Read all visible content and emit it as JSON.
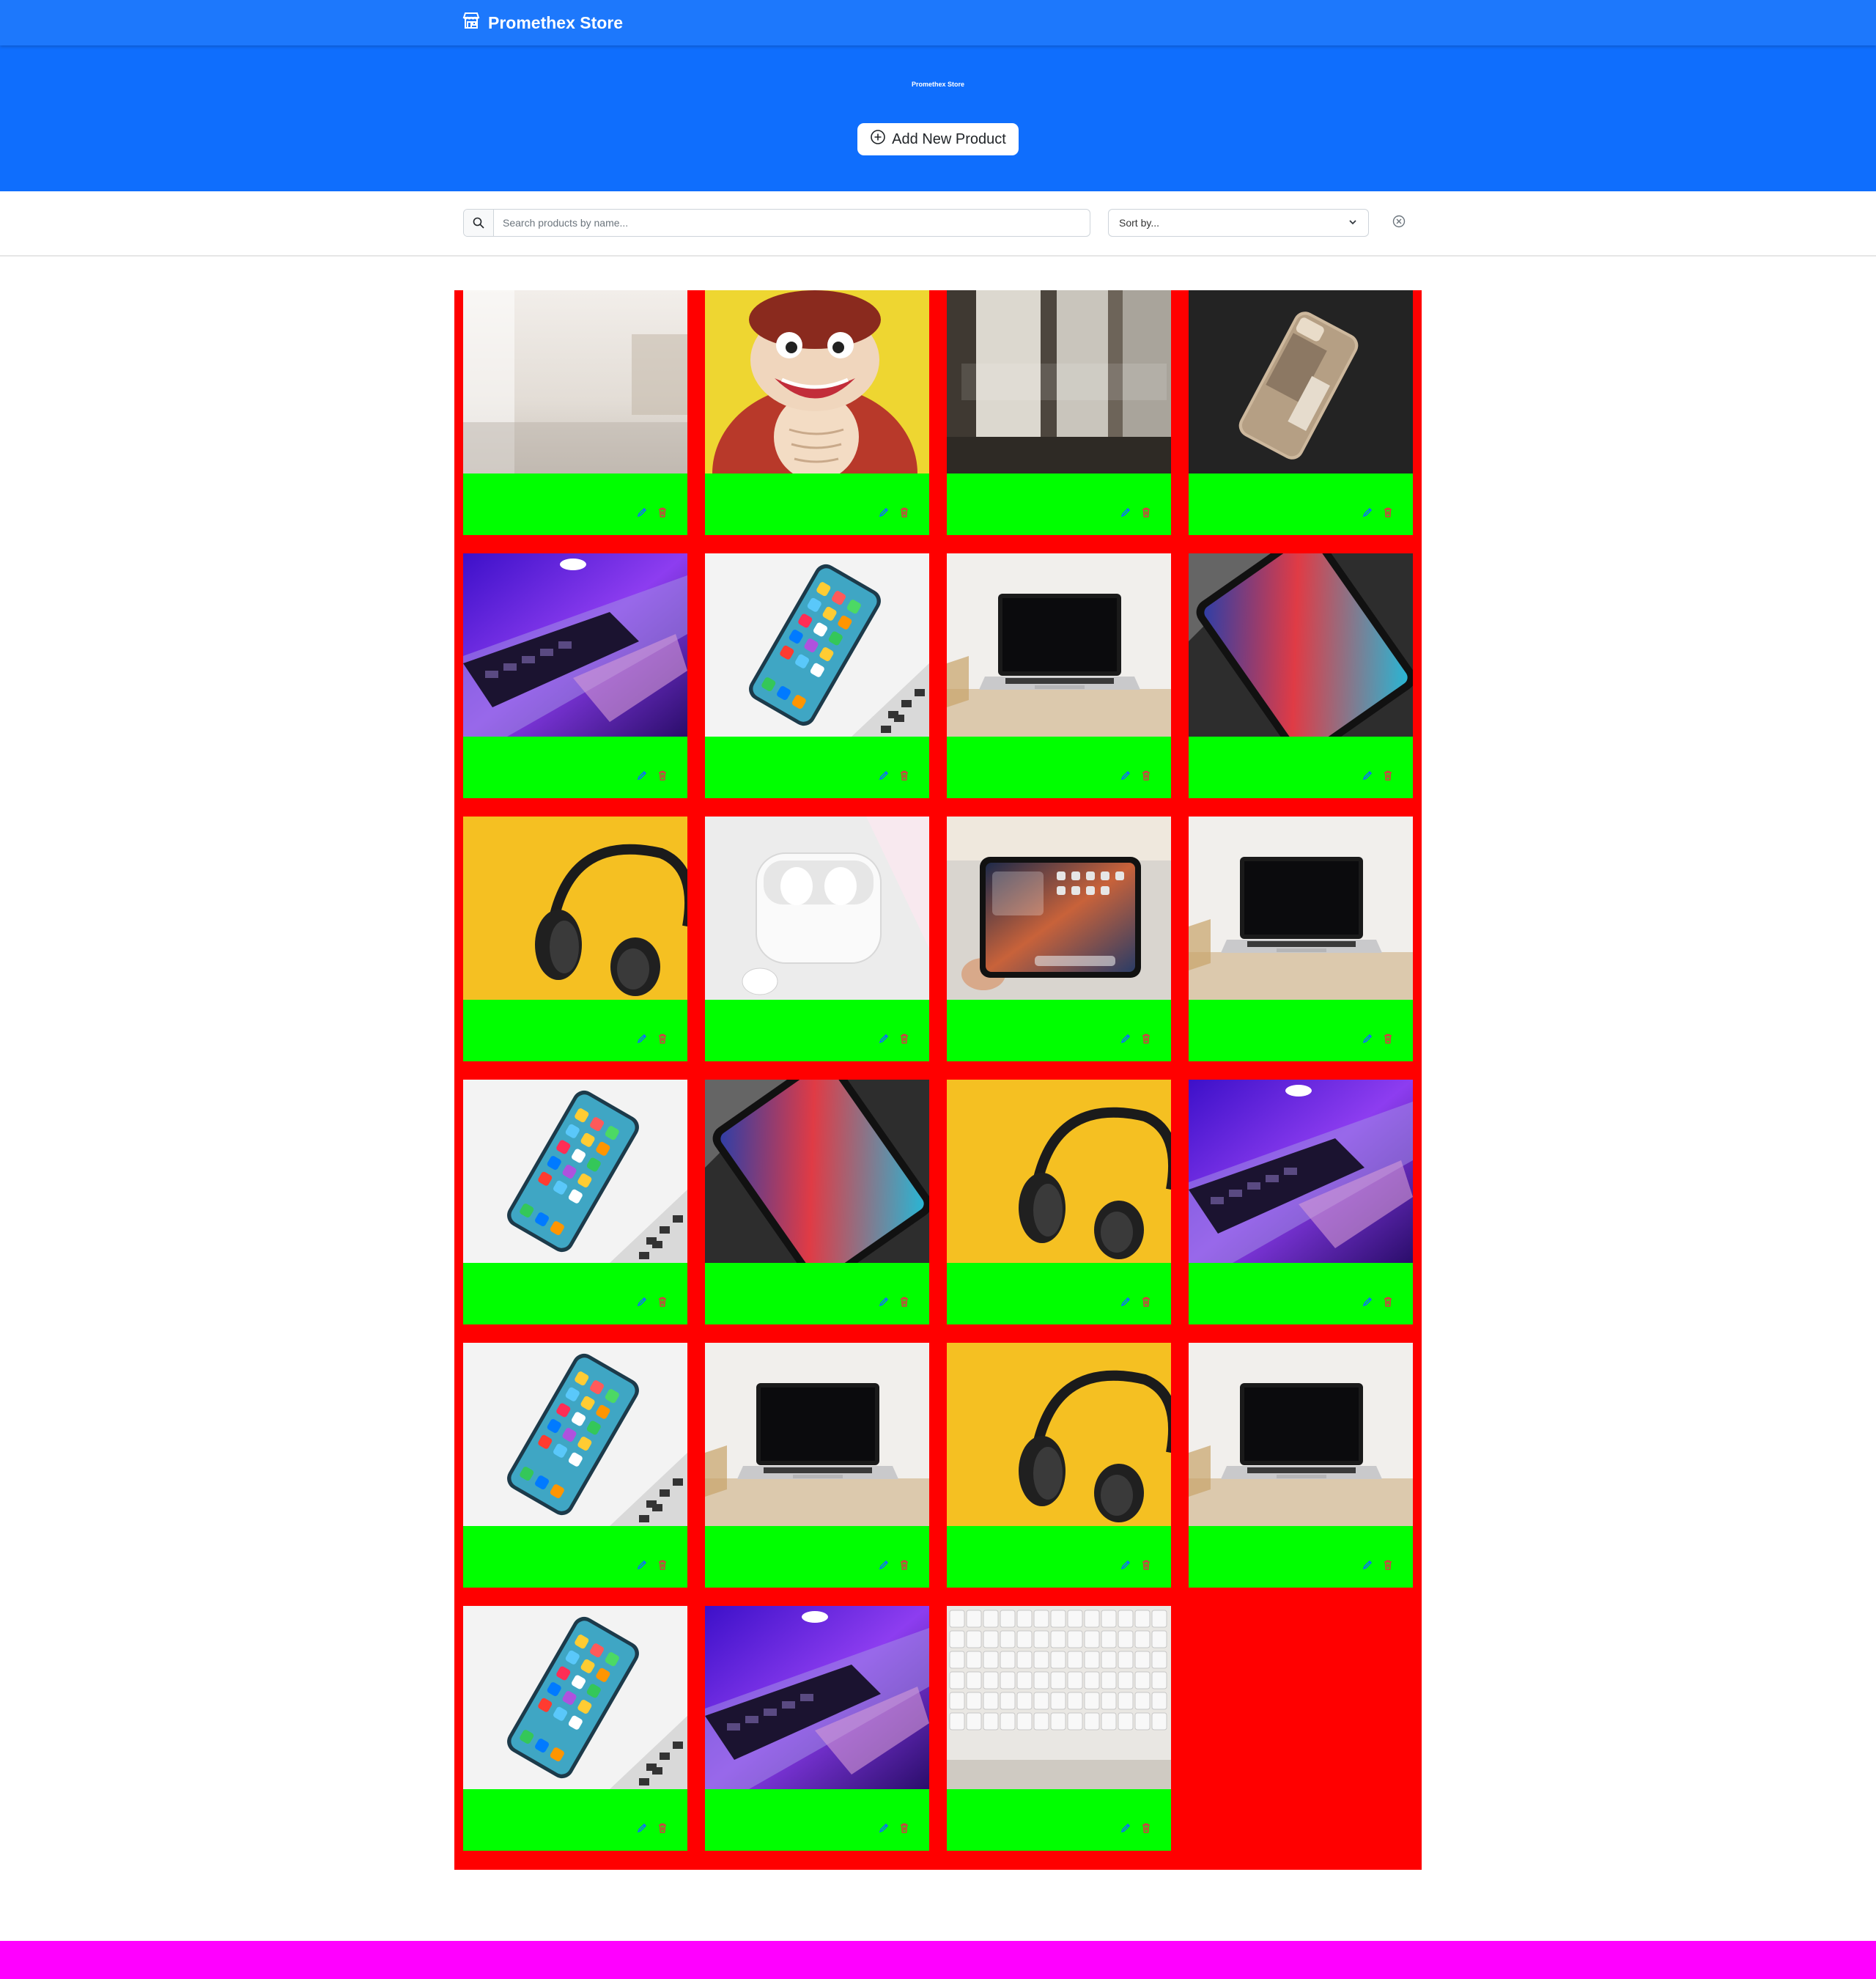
{
  "navbar": {
    "brand": "Promethex Store",
    "brand_icon": "shop-icon"
  },
  "hero": {
    "title": "Promethex Store",
    "subtitle": "",
    "add_button_label": "Add New Product",
    "add_button_icon": "plus-circle-icon"
  },
  "filters": {
    "search_placeholder": "Search products by name...",
    "search_icon": "search-icon",
    "sort_label": "Sort by...",
    "sort_icon": "chevron-down-icon",
    "clear_icon": "clear-filters-icon"
  },
  "colors": {
    "navbar": "#1d78fc",
    "hero": "#0f6efd",
    "grid_background": "#ff0000",
    "card_body": "#00ff00",
    "footer": "#ff00ff",
    "edit_icon": "#0d6efd",
    "delete_icon": "#dc3545"
  },
  "products": [
    {
      "image": "blurred-room"
    },
    {
      "image": "cartoon-gorilla"
    },
    {
      "image": "window-interior"
    },
    {
      "image": "gold-iphone-15"
    },
    {
      "image": "purple-laptop"
    },
    {
      "image": "iphone-on-laptop"
    },
    {
      "image": "macbook-on-desk"
    },
    {
      "image": "ipad-dark"
    },
    {
      "image": "headphones-yellow"
    },
    {
      "image": "airpods-pro"
    },
    {
      "image": "ipad-in-hand"
    },
    {
      "image": "macbook-on-desk"
    },
    {
      "image": "iphone-on-laptop"
    },
    {
      "image": "ipad-dark"
    },
    {
      "image": "headphones-yellow"
    },
    {
      "image": "purple-laptop"
    },
    {
      "image": "iphone-on-laptop"
    },
    {
      "image": "macbook-on-desk"
    },
    {
      "image": "headphones-yellow"
    },
    {
      "image": "macbook-on-desk"
    },
    {
      "image": "iphone-on-laptop"
    },
    {
      "image": "purple-laptop"
    },
    {
      "image": "white-keyboard"
    }
  ]
}
